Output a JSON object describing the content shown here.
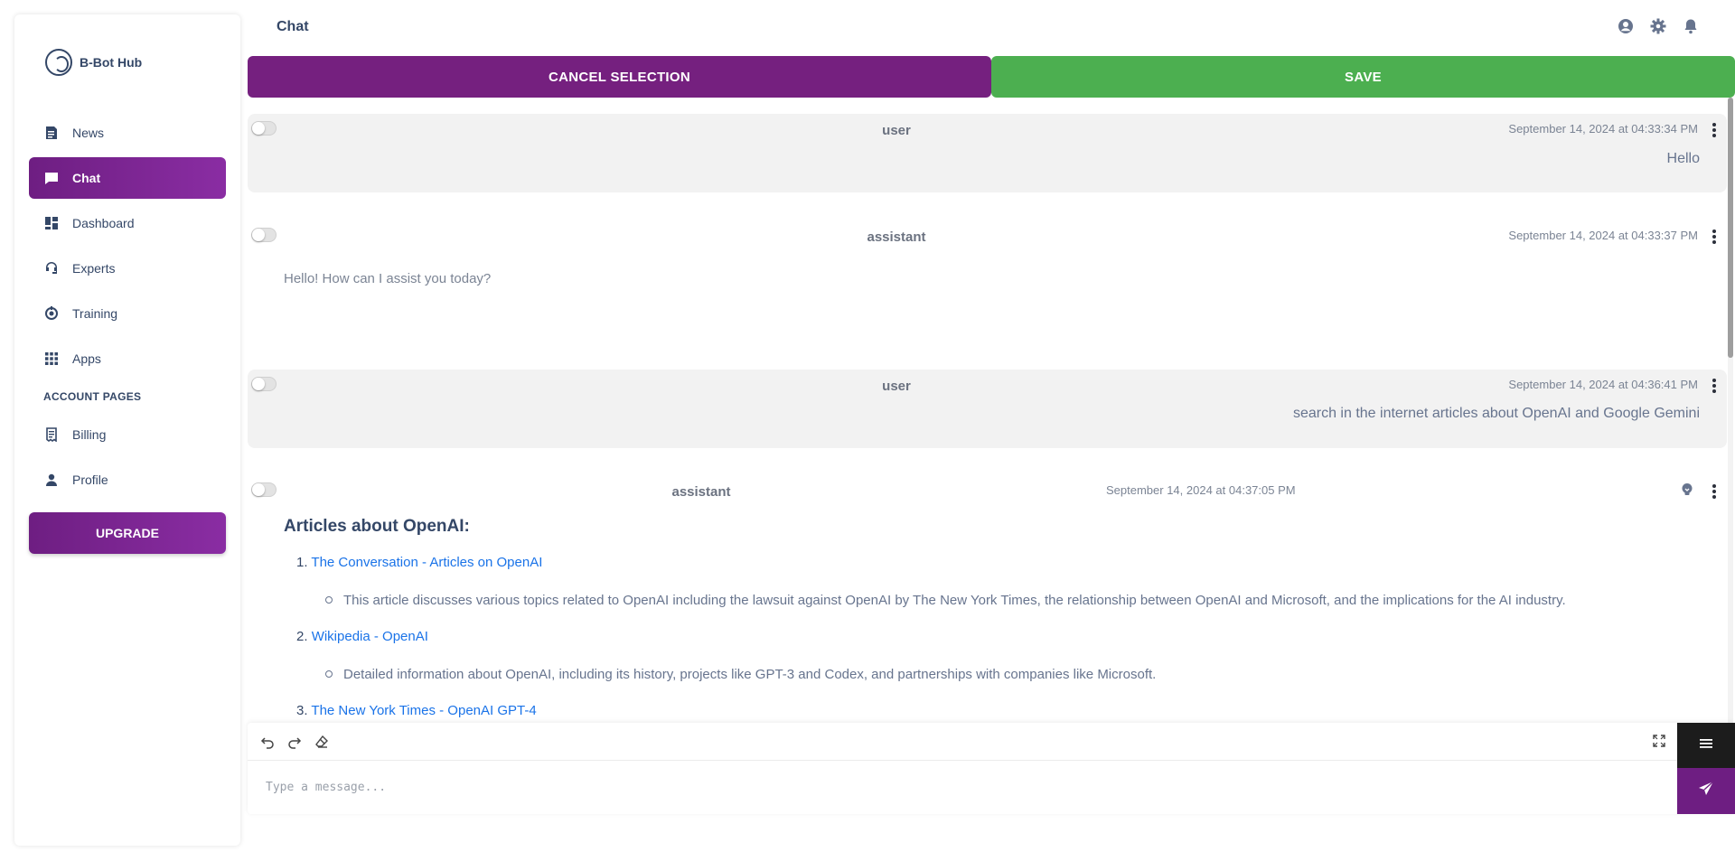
{
  "brand": {
    "name": "B-Bot Hub"
  },
  "sidebar": {
    "items": [
      {
        "label": "News",
        "icon": "newspaper-icon"
      },
      {
        "label": "Chat",
        "icon": "chat-icon",
        "active": true
      },
      {
        "label": "Dashboard",
        "icon": "dashboard-icon"
      },
      {
        "label": "Experts",
        "icon": "headset-icon"
      },
      {
        "label": "Training",
        "icon": "training-icon"
      },
      {
        "label": "Apps",
        "icon": "apps-grid-icon"
      }
    ],
    "section_label": "ACCOUNT PAGES",
    "account_items": [
      {
        "label": "Billing",
        "icon": "receipt-icon"
      },
      {
        "label": "Profile",
        "icon": "person-icon"
      }
    ],
    "upgrade_label": "UPGRADE"
  },
  "header": {
    "title": "Chat",
    "icons": [
      "account-circle-icon",
      "settings-gear-icon",
      "notification-bell-icon"
    ]
  },
  "actions": {
    "cancel_label": "CANCEL SELECTION",
    "save_label": "SAVE"
  },
  "messages": [
    {
      "role": "user",
      "timestamp": "September 14, 2024 at 04:33:34 PM",
      "text": "Hello"
    },
    {
      "role": "assistant",
      "timestamp": "September 14, 2024 at 04:33:37 PM",
      "text": "Hello! How can I assist you today?"
    },
    {
      "role": "user",
      "timestamp": "September 14, 2024 at 04:36:41 PM",
      "text": "search in the internet articles about OpenAI and Google Gemini"
    },
    {
      "role": "assistant",
      "timestamp": "September 14, 2024 at 04:37:05 PM",
      "heading": "Articles about OpenAI:",
      "items": [
        {
          "num": "1.",
          "link": "The Conversation - Articles on OpenAI",
          "desc": "This article discusses various topics related to OpenAI including the lawsuit against OpenAI by The New York Times, the relationship between OpenAI and Microsoft, and the implications for the AI industry."
        },
        {
          "num": "2.",
          "link": "Wikipedia - OpenAI",
          "desc": "Detailed information about OpenAI, including its history, projects like GPT-3 and Codex, and partnerships with companies like Microsoft."
        },
        {
          "num": "3.",
          "link": "The New York Times - OpenAI GPT-4"
        }
      ]
    }
  ],
  "composer": {
    "placeholder": "Type a message...",
    "toolbar_icons": [
      "undo-icon",
      "redo-icon",
      "eraser-icon"
    ]
  },
  "colors": {
    "brand_purple": "#75207f",
    "save_green": "#4caf50",
    "link_blue": "#1a73e8",
    "user_bubble": "#f2f2f2"
  }
}
